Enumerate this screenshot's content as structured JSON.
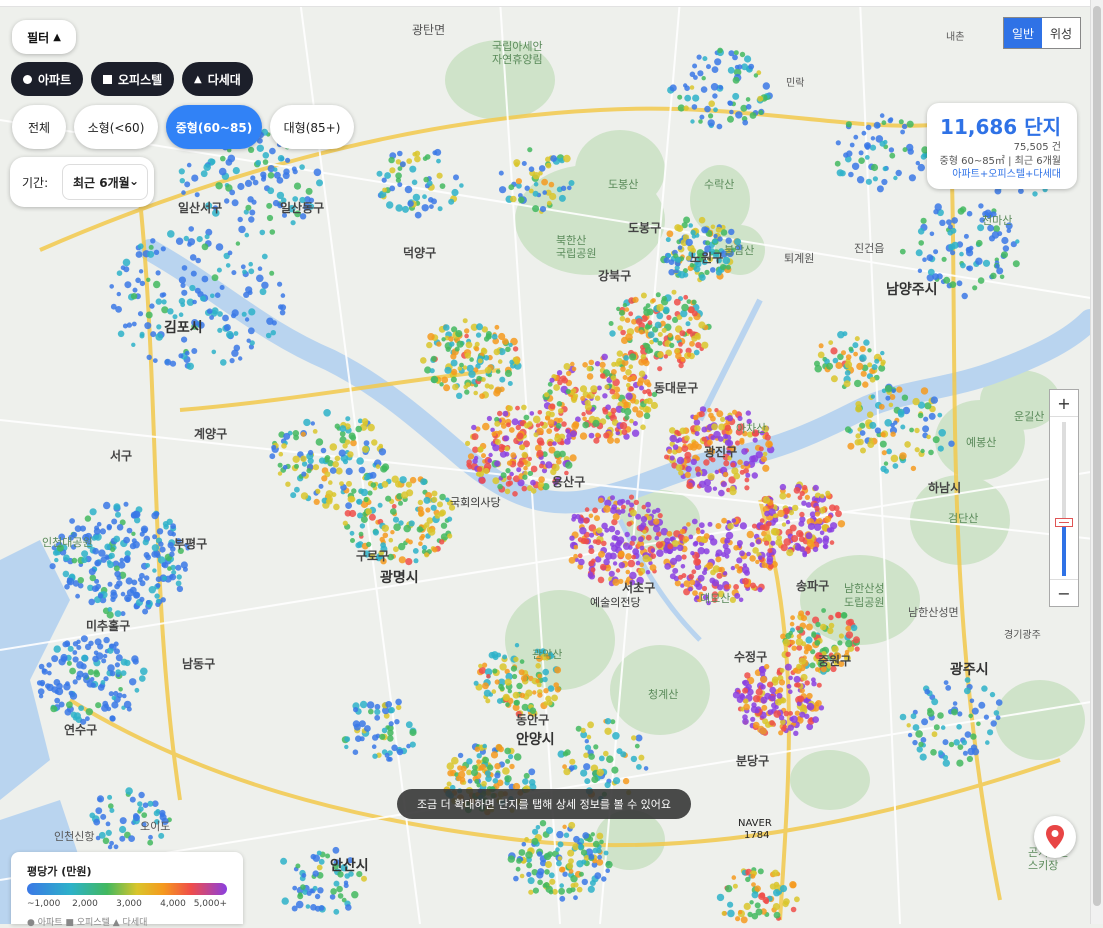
{
  "filters": {
    "toggle_label": "필터",
    "types": [
      "아파트",
      "오피스텔",
      "다세대"
    ],
    "sizes": [
      "전체",
      "소형(<60)",
      "중형(60~85)",
      "대형(85+)"
    ],
    "active_size": "중형(60~85)",
    "period_label": "기간:",
    "period_value": "최근 6개월"
  },
  "map_type": {
    "normal": "일반",
    "satellite": "위성",
    "active": "일반"
  },
  "stats": {
    "complex_count": "11,686 단지",
    "deal_count": "75,505 건",
    "condition": "중형 60~85㎡ | 최근 6개월",
    "types": "아파트+오피스텔+다세대"
  },
  "zoom": {
    "plus": "+",
    "minus": "−",
    "level": 0.35
  },
  "toast": "조금 더 확대하면 단지를 탭해 상세 정보를 볼 수 있어요",
  "legend": {
    "title": "평당가 (만원)",
    "ticks": [
      "~1,000",
      "2,000",
      "3,000",
      "4,000",
      "5,000+"
    ],
    "types_line": "● 아파트  ■ 오피스텔  ▲ 다세대"
  },
  "colors": {
    "accent": "#3182f6",
    "scale": [
      "#3a78e6",
      "#2db2c9",
      "#42b85f",
      "#d9c52b",
      "#f59a1e",
      "#ef4d4a",
      "#8a3fe0"
    ],
    "river": "#b9d4ef",
    "park": "#cfe3c9"
  },
  "map_places": [
    {
      "name": "광탄면"
    },
    {
      "name": "국립아세안 자연휴양림"
    },
    {
      "name": "일산서구"
    },
    {
      "name": "일산동구"
    },
    {
      "name": "덕양구"
    },
    {
      "name": "김포시"
    },
    {
      "name": "도봉구"
    },
    {
      "name": "노원구"
    },
    {
      "name": "강북구"
    },
    {
      "name": "남양주시"
    },
    {
      "name": "동대문구"
    },
    {
      "name": "광진구"
    },
    {
      "name": "용산구"
    },
    {
      "name": "국회의사당"
    },
    {
      "name": "계양구"
    },
    {
      "name": "서구"
    },
    {
      "name": "부평구"
    },
    {
      "name": "구로구"
    },
    {
      "name": "광명시"
    },
    {
      "name": "서초구"
    },
    {
      "name": "예술의전당"
    },
    {
      "name": "송파구"
    },
    {
      "name": "하남시"
    },
    {
      "name": "중원구"
    },
    {
      "name": "수정구"
    },
    {
      "name": "분당구"
    },
    {
      "name": "광주시"
    },
    {
      "name": "안양시"
    },
    {
      "name": "동안구"
    },
    {
      "name": "남동구"
    },
    {
      "name": "미추홀구"
    },
    {
      "name": "연수구"
    },
    {
      "name": "안산시"
    },
    {
      "name": "청계산"
    },
    {
      "name": "관악산"
    },
    {
      "name": "남한산성 도립공원"
    },
    {
      "name": "북한산 국립공원"
    },
    {
      "name": "수락산"
    },
    {
      "name": "불암산"
    },
    {
      "name": "도봉산"
    },
    {
      "name": "아차산"
    },
    {
      "name": "대모산"
    },
    {
      "name": "검단산"
    },
    {
      "name": "예봉산"
    },
    {
      "name": "운길산"
    },
    {
      "name": "천마산"
    },
    {
      "name": "인천대공원"
    },
    {
      "name": "인천신항"
    },
    {
      "name": "오이도"
    },
    {
      "name": "NAVER 1784"
    },
    {
      "name": "곤지암천 스키장"
    },
    {
      "name": "남한산성면"
    },
    {
      "name": "경기광주"
    },
    {
      "name": "퇴계원"
    },
    {
      "name": "진건읍"
    },
    {
      "name": "내촌"
    },
    {
      "name": "민락"
    }
  ]
}
